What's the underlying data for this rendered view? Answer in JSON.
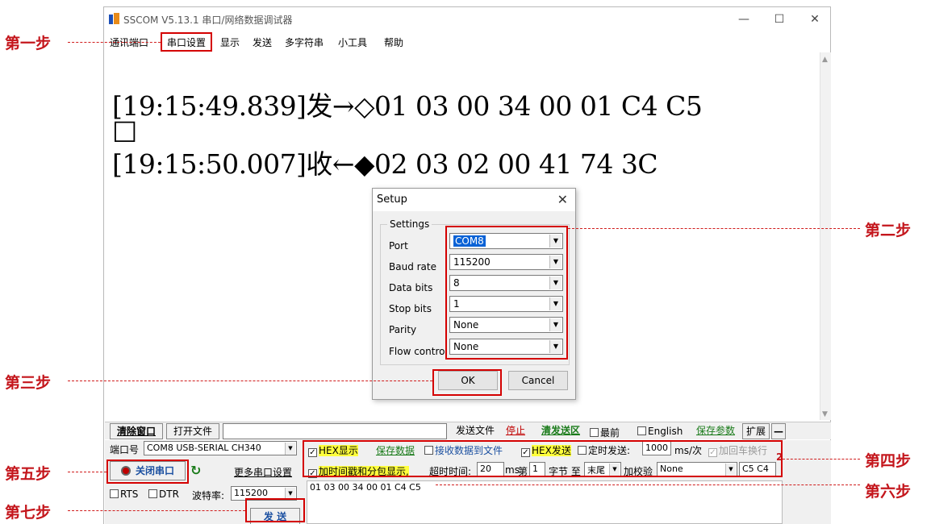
{
  "window": {
    "title": "SSCOM V5.13.1 串口/网络数据调试器",
    "controls": {
      "minimize": "—",
      "maximize": "☐",
      "close": "✕"
    }
  },
  "menu": [
    "通讯端口",
    "串口设置",
    "显示",
    "发送",
    "多字符串",
    "小工具",
    "帮助"
  ],
  "output": {
    "lines": [
      "[19:15:49.839]发→◇01 03 00 34 00 01 C4 C5",
      "□",
      "[19:15:50.007]收←◆02 03 02 00 41 74 3C"
    ]
  },
  "dialog": {
    "title": "Setup",
    "group": "Settings",
    "fields": [
      {
        "label": "Port",
        "value": "COM8"
      },
      {
        "label": "Baud rate",
        "value": "115200"
      },
      {
        "label": "Data bits",
        "value": "8"
      },
      {
        "label": "Stop bits",
        "value": "1"
      },
      {
        "label": "Parity",
        "value": "None"
      },
      {
        "label": "Flow control",
        "value": "None"
      }
    ],
    "ok": "OK",
    "cancel": "Cancel"
  },
  "toolbar": {
    "clear": "清除窗口",
    "open_file": "打开文件",
    "send_file": "发送文件",
    "stop": "停止",
    "clear_send": "清发送区",
    "top": "最前",
    "english": "English",
    "save_params": "保存参数",
    "expand": "扩展",
    "collapse": "—"
  },
  "panel": {
    "port_label": "端口号",
    "port_value": "COM8 USB-SERIAL CH340",
    "open_port": "关闭串口",
    "more_settings": "更多串口设置",
    "rts": "RTS",
    "dtr": "DTR",
    "baud_label": "波特率:",
    "baud_value": "115200",
    "send": "发 送",
    "hex_display": "HEX显示",
    "save_data": "保存数据",
    "recv_to_file": "接收数据到文件",
    "hex_send": "HEX发送",
    "timed_send": "定时发送:",
    "timed_value": "1000",
    "timed_unit": "ms/次",
    "add_crlf": "加回车换行",
    "timestamp": "加时间戳和分包显示,",
    "timeout_label": "超时时间:",
    "timeout_value": "20",
    "ms": "ms",
    "nth": "第",
    "nth_value": "1",
    "byte_to": "字节 至",
    "end_value": "末尾",
    "checksum_label": "加校验",
    "checksum_value": "None",
    "checksum_result": "C5 C4",
    "send_data": "01 03 00 34 00 01 C4 C5"
  },
  "steps": {
    "s1": "第一步",
    "s2": "第二步",
    "s3": "第三步",
    "s4": "第四步",
    "s5": "第五步",
    "s6": "第六步",
    "s7": "第七步",
    "mark2": "2"
  }
}
